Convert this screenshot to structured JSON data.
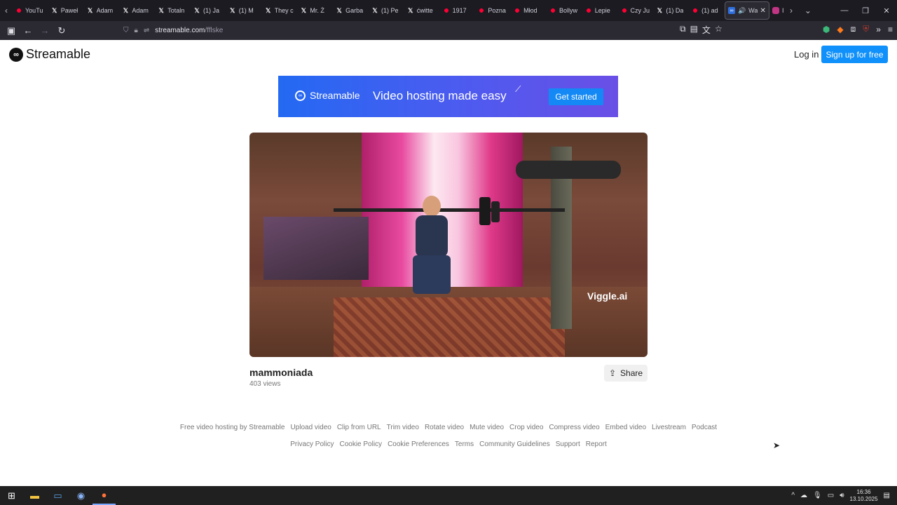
{
  "browser": {
    "tabs": [
      {
        "label": "YouTu",
        "icon": "youtube-icon"
      },
      {
        "label": "Paweł",
        "icon": "x-icon"
      },
      {
        "label": "Adam",
        "icon": "x-icon"
      },
      {
        "label": "Adam",
        "icon": "x-icon"
      },
      {
        "label": "Totaln",
        "icon": "x-icon"
      },
      {
        "label": "(1) Ja",
        "icon": "x-icon"
      },
      {
        "label": "(1) M",
        "icon": "x-icon"
      },
      {
        "label": "They c",
        "icon": "x-icon"
      },
      {
        "label": "Mr. Ż",
        "icon": "x-icon"
      },
      {
        "label": "Garba",
        "icon": "x-icon"
      },
      {
        "label": "(1) Pe",
        "icon": "x-icon"
      },
      {
        "label": "ćwitte",
        "icon": "x-icon"
      },
      {
        "label": "1917",
        "icon": "youtube-icon"
      },
      {
        "label": "Pozna",
        "icon": "youtube-icon"
      },
      {
        "label": "Młod",
        "icon": "youtube-icon"
      },
      {
        "label": "Bollyw",
        "icon": "youtube-icon"
      },
      {
        "label": "Lepie",
        "icon": "youtube-icon"
      },
      {
        "label": "Czy Ju",
        "icon": "youtube-icon"
      },
      {
        "label": "(1) Da",
        "icon": "x-icon"
      },
      {
        "label": "(1) ad",
        "icon": "youtube-icon"
      }
    ],
    "active_tab": {
      "label": "Wa",
      "icon": "streamable-icon"
    },
    "next_tab_label": "I",
    "url_host": "streamable.com",
    "url_path": "/fflske"
  },
  "site": {
    "brand": "Streamable",
    "login": "Log in",
    "signup": "Sign up for free"
  },
  "banner": {
    "brand": "Streamable",
    "headline": "Video hosting made easy",
    "cta": "Get started"
  },
  "video": {
    "watermark": "Viggle.ai",
    "title": "mammoniada",
    "views": "403 views",
    "share": "Share"
  },
  "footer": {
    "row1": [
      "Free video hosting by Streamable",
      "Upload video",
      "Clip from URL",
      "Trim video",
      "Rotate video",
      "Mute video",
      "Crop video",
      "Compress video",
      "Embed video",
      "Livestream",
      "Podcast"
    ],
    "row2": [
      "Privacy Policy",
      "Cookie Policy",
      "Cookie Preferences",
      "Terms",
      "Community Guidelines",
      "Support",
      "Report"
    ]
  },
  "taskbar": {
    "time": "16:36",
    "date": "13.10.2025"
  },
  "colors": {
    "brand_blue": "#0f90fa",
    "chrome_dark": "#1c1b22",
    "taskbar": "#202020"
  }
}
